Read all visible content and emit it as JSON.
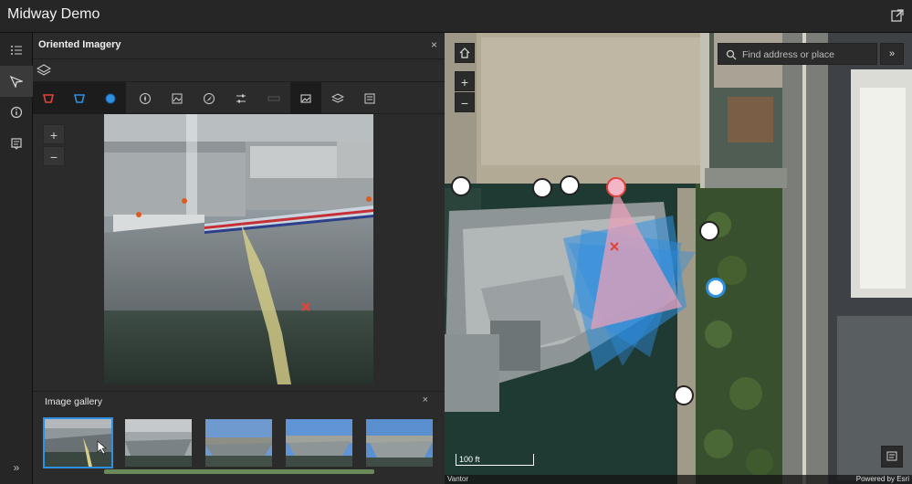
{
  "app": {
    "title": "Midway Demo"
  },
  "panel": {
    "title": "Oriented Imagery",
    "close": "×",
    "zoom_in": "+",
    "zoom_out": "−"
  },
  "toolbar": {
    "tools": [
      {
        "name": "camera-location-tool",
        "color": "#e0443a"
      },
      {
        "name": "image-footprint-tool",
        "color": "#2f8fe0"
      },
      {
        "name": "coverage-tool",
        "color": "#2f8fe0"
      },
      {
        "name": "direction-tool"
      },
      {
        "name": "image-to-map-tool"
      },
      {
        "name": "navigate-tool"
      },
      {
        "name": "image-enhancement-tool"
      },
      {
        "name": "measure-tool"
      },
      {
        "name": "image-gallery-tool"
      },
      {
        "name": "layers-tool"
      },
      {
        "name": "export-tool"
      }
    ]
  },
  "gallery": {
    "title": "Image gallery",
    "close": "×",
    "thumbnails": 5,
    "selected_index": 0
  },
  "map": {
    "search_placeholder": "Find address or place",
    "expand_label": "»",
    "zoom_in": "+",
    "zoom_out": "−",
    "scale_label": "100 ft",
    "attribution_left": "Vantor",
    "attribution_right": "Powered by Esri"
  },
  "nav": {
    "collapse_label": "»"
  },
  "colors": {
    "accent": "#2f8fe0",
    "camera_red": "#e0443a",
    "footprint_pink": "#e8a0b8"
  }
}
